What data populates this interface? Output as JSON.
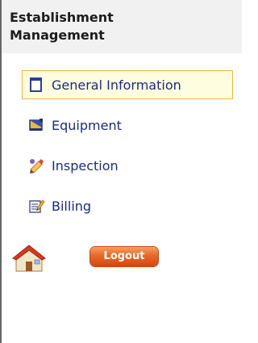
{
  "header": {
    "title_line1": "Establishment",
    "title_line2": "Management"
  },
  "nav": {
    "items": [
      {
        "label": "General Information",
        "icon": "document-icon",
        "selected": true
      },
      {
        "label": "Equipment",
        "icon": "equipment-icon",
        "selected": false
      },
      {
        "label": "Inspection",
        "icon": "inspection-icon",
        "selected": false
      },
      {
        "label": "Billing",
        "icon": "billing-icon",
        "selected": false
      }
    ]
  },
  "footer": {
    "home_icon": "home-icon",
    "logout_label": "Logout"
  },
  "colors": {
    "header_bg": "#f1f1f1",
    "nav_text": "#1c2b7d",
    "selected_bg": "#fffddf",
    "selected_border": "#f2b43b",
    "logout_orange": "#e8682a"
  }
}
